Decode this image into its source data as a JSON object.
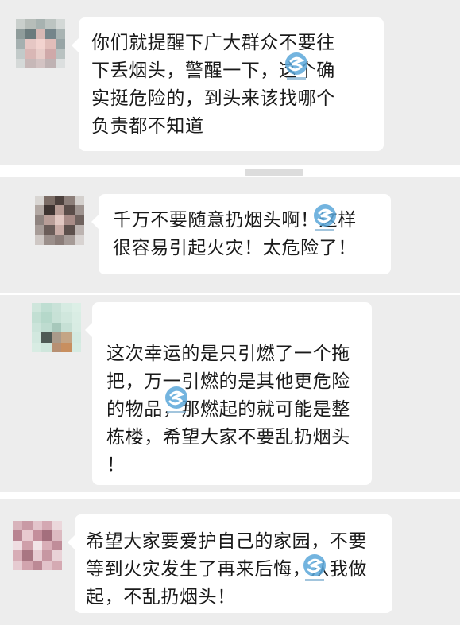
{
  "colors": {
    "panel_background": "#ededed",
    "bubble_background": "#ffffff",
    "text": "#1a1a1a",
    "watermark": "#5aa7d9"
  },
  "messages": [
    {
      "avatar_icon": "user-avatar-icon",
      "lines": [
        "你们就提醒下广大群众不要往",
        "下丢烟头，警醒一下，这个确",
        "实挺危险的，到头来该找哪个",
        "负责都不知道"
      ]
    },
    {
      "avatar_icon": "user-avatar-icon",
      "lines": [
        "千万不要随意扔烟头啊！这样",
        "很容易引起火灾！太危险了！"
      ]
    },
    {
      "avatar_icon": "user-avatar-icon",
      "lines": [
        "这次幸运的是只引燃了一个拖",
        "把，万一引燃的是其他更危险",
        "的物品，那燃起的就可能是整",
        "栋楼，希望大家不要乱扔烟头",
        "！"
      ]
    },
    {
      "avatar_icon": "user-avatar-icon",
      "lines": [
        "希望大家要爱护自己的家园，不要",
        "等到火灾发生了再来后悔，从我做",
        "起，不乱扔烟头！"
      ]
    }
  ],
  "watermark_icon": "watermark-logo-icon"
}
